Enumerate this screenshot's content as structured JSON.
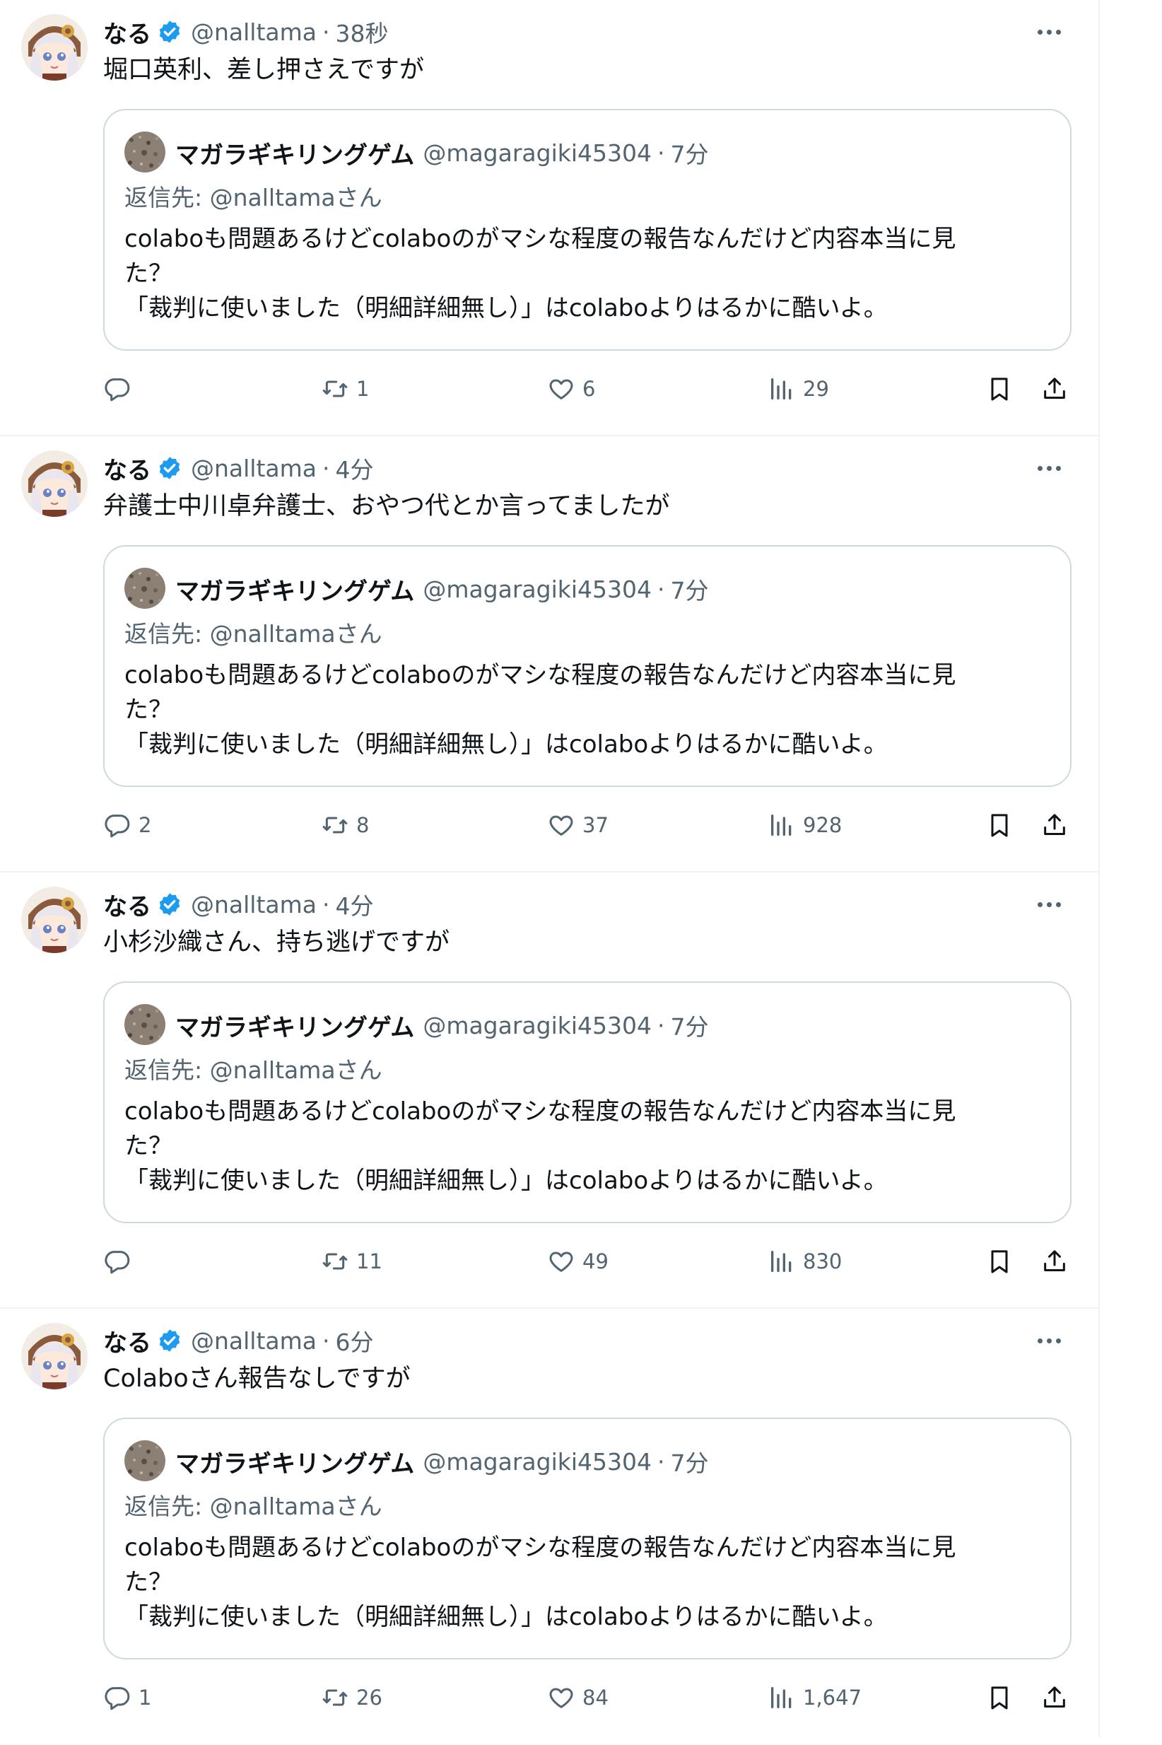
{
  "colors": {
    "text_primary": "#0f1419",
    "text_secondary": "#536471",
    "border": "#cfd9de",
    "verified_blue": "#1d9bf0"
  },
  "tweets": [
    {
      "author_name": "なる",
      "author_handle": "@nalltama",
      "separator": "·",
      "time": "38秒",
      "text": "堀口英利、差し押さえですが",
      "quote": {
        "author_name": "マガラギキリングゲム",
        "author_handle": "@magaragiki45304",
        "separator": "·",
        "time": "7分",
        "reply_prefix": "返信先: ",
        "reply_to": "@nalltamaさん",
        "lines": [
          "colaboも問題あるけどcolaboのがマシな程度の報告なんだけど内容本当に見",
          "た？",
          "「裁判に使いました（明細詳細無し）」はcolaboよりはるかに酷いよ。"
        ]
      },
      "stats": {
        "replies": "",
        "retweets": "1",
        "likes": "6",
        "views": "29"
      }
    },
    {
      "author_name": "なる",
      "author_handle": "@nalltama",
      "separator": "·",
      "time": "4分",
      "text": "弁護士中川卓弁護士、おやつ代とか言ってましたが",
      "quote": {
        "author_name": "マガラギキリングゲム",
        "author_handle": "@magaragiki45304",
        "separator": "·",
        "time": "7分",
        "reply_prefix": "返信先: ",
        "reply_to": "@nalltamaさん",
        "lines": [
          "colaboも問題あるけどcolaboのがマシな程度の報告なんだけど内容本当に見",
          "た？",
          "「裁判に使いました（明細詳細無し）」はcolaboよりはるかに酷いよ。"
        ]
      },
      "stats": {
        "replies": "2",
        "retweets": "8",
        "likes": "37",
        "views": "928"
      }
    },
    {
      "author_name": "なる",
      "author_handle": "@nalltama",
      "separator": "·",
      "time": "4分",
      "text": "小杉沙織さん、持ち逃げですが",
      "quote": {
        "author_name": "マガラギキリングゲム",
        "author_handle": "@magaragiki45304",
        "separator": "·",
        "time": "7分",
        "reply_prefix": "返信先: ",
        "reply_to": "@nalltamaさん",
        "lines": [
          "colaboも問題あるけどcolaboのがマシな程度の報告なんだけど内容本当に見",
          "た？",
          "「裁判に使いました（明細詳細無し）」はcolaboよりはるかに酷いよ。"
        ]
      },
      "stats": {
        "replies": "",
        "retweets": "11",
        "likes": "49",
        "views": "830"
      }
    },
    {
      "author_name": "なる",
      "author_handle": "@nalltama",
      "separator": "·",
      "time": "6分",
      "text": "Colaboさん報告なしですが",
      "quote": {
        "author_name": "マガラギキリングゲム",
        "author_handle": "@magaragiki45304",
        "separator": "·",
        "time": "7分",
        "reply_prefix": "返信先: ",
        "reply_to": "@nalltamaさん",
        "lines": [
          "colaboも問題あるけどcolaboのがマシな程度の報告なんだけど内容本当に見",
          "た？",
          "「裁判に使いました（明細詳細無し）」はcolaboよりはるかに酷いよ。"
        ]
      },
      "stats": {
        "replies": "1",
        "retweets": "26",
        "likes": "84",
        "views": "1,647"
      }
    }
  ]
}
